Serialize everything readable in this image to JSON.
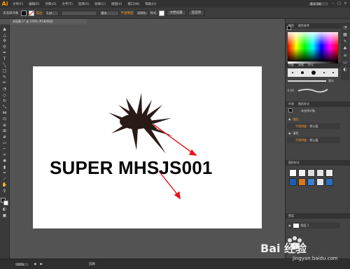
{
  "app": {
    "logo": "Ai"
  },
  "menu": {
    "items": [
      "文件(F)",
      "编辑(E)",
      "对象(O)",
      "文字(T)",
      "选择(S)",
      "效果(C)",
      "视图(V)",
      "窗口(W)",
      "帮助(H)"
    ]
  },
  "workspace": {
    "label": "基本功能"
  },
  "control": {
    "selection_label": "未选择对象",
    "stroke_label": "描边",
    "stroke_weight": "1 pt",
    "stroke_style": "基本",
    "opacity_label": "不透明度",
    "opacity_value": "100%",
    "style_label": "样式",
    "doc_setup_button": "文档设置",
    "prefs_button": "首选项"
  },
  "document": {
    "tab_label": "未标题-1* @ 100% (RGB/预览)"
  },
  "artboard": {
    "headline": "SUPER MHSJS001"
  },
  "panels": {
    "color_tabs": [
      "颜色",
      "颜色参考"
    ],
    "brush_tabs": [
      "色板",
      "画笔",
      "符号"
    ],
    "brush_size": "6.00",
    "brush_label": "基本",
    "appearance_tabs": [
      "外观",
      "图形样式"
    ],
    "appearance_title": "未选择对象",
    "stroke_row": "描边",
    "fill_row": "填色",
    "opacity_row": "不透明度:",
    "opacity_default": "默认值",
    "symbol_title": "图形样式",
    "layers_tab": "图层",
    "layer_name": "图层 1"
  },
  "status": {
    "zoom": "100%",
    "tool": "选择"
  },
  "watermark": {
    "text": "Bai 经验",
    "url": "jingyan.baidu.com"
  },
  "colors": {
    "accent_orange": "#ff9a00",
    "annotation_red": "#e8141a",
    "splat": "#2a1a17"
  }
}
